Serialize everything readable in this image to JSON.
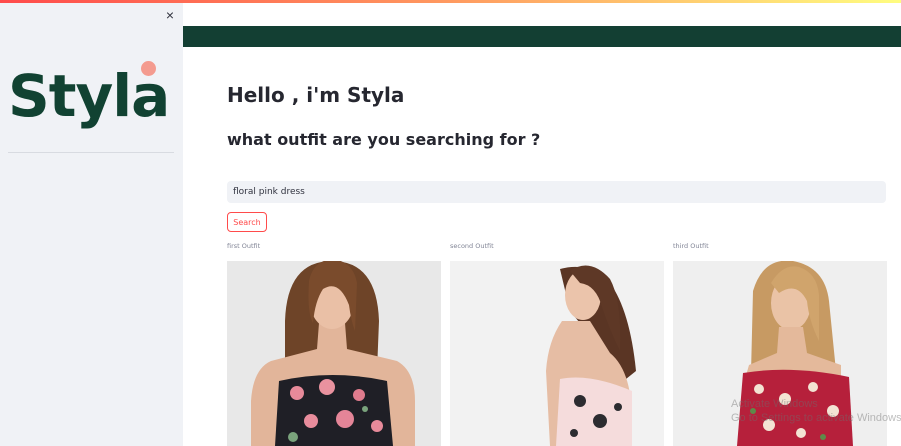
{
  "sidebar": {
    "close_label": "×",
    "logo_text": "Styla",
    "close_icon": "close-icon"
  },
  "main": {
    "greeting": "Hello , i'm Styla",
    "question": "what outfit are you searching for ?",
    "search": {
      "value": "floral pink dress",
      "button_label": "Search"
    },
    "outfits": [
      {
        "caption": "first Outfit",
        "image": "model-black-floral-strapless-dress-photo"
      },
      {
        "caption": "second Outfit",
        "image": "model-pink-floral-strapless-dress-photo"
      },
      {
        "caption": "third Outfit",
        "image": "model-red-floral-off-shoulder-dress-photo"
      }
    ]
  },
  "watermark": {
    "line1": "Activate Windows",
    "line2": "Go to Settings to activate Windows."
  },
  "colors": {
    "brand_dark_green": "#133f33",
    "logo_green": "#114232",
    "logo_dot": "#f49b8f",
    "accent_red": "#ff4b4b",
    "sidebar_bg": "#f0f2f6"
  }
}
